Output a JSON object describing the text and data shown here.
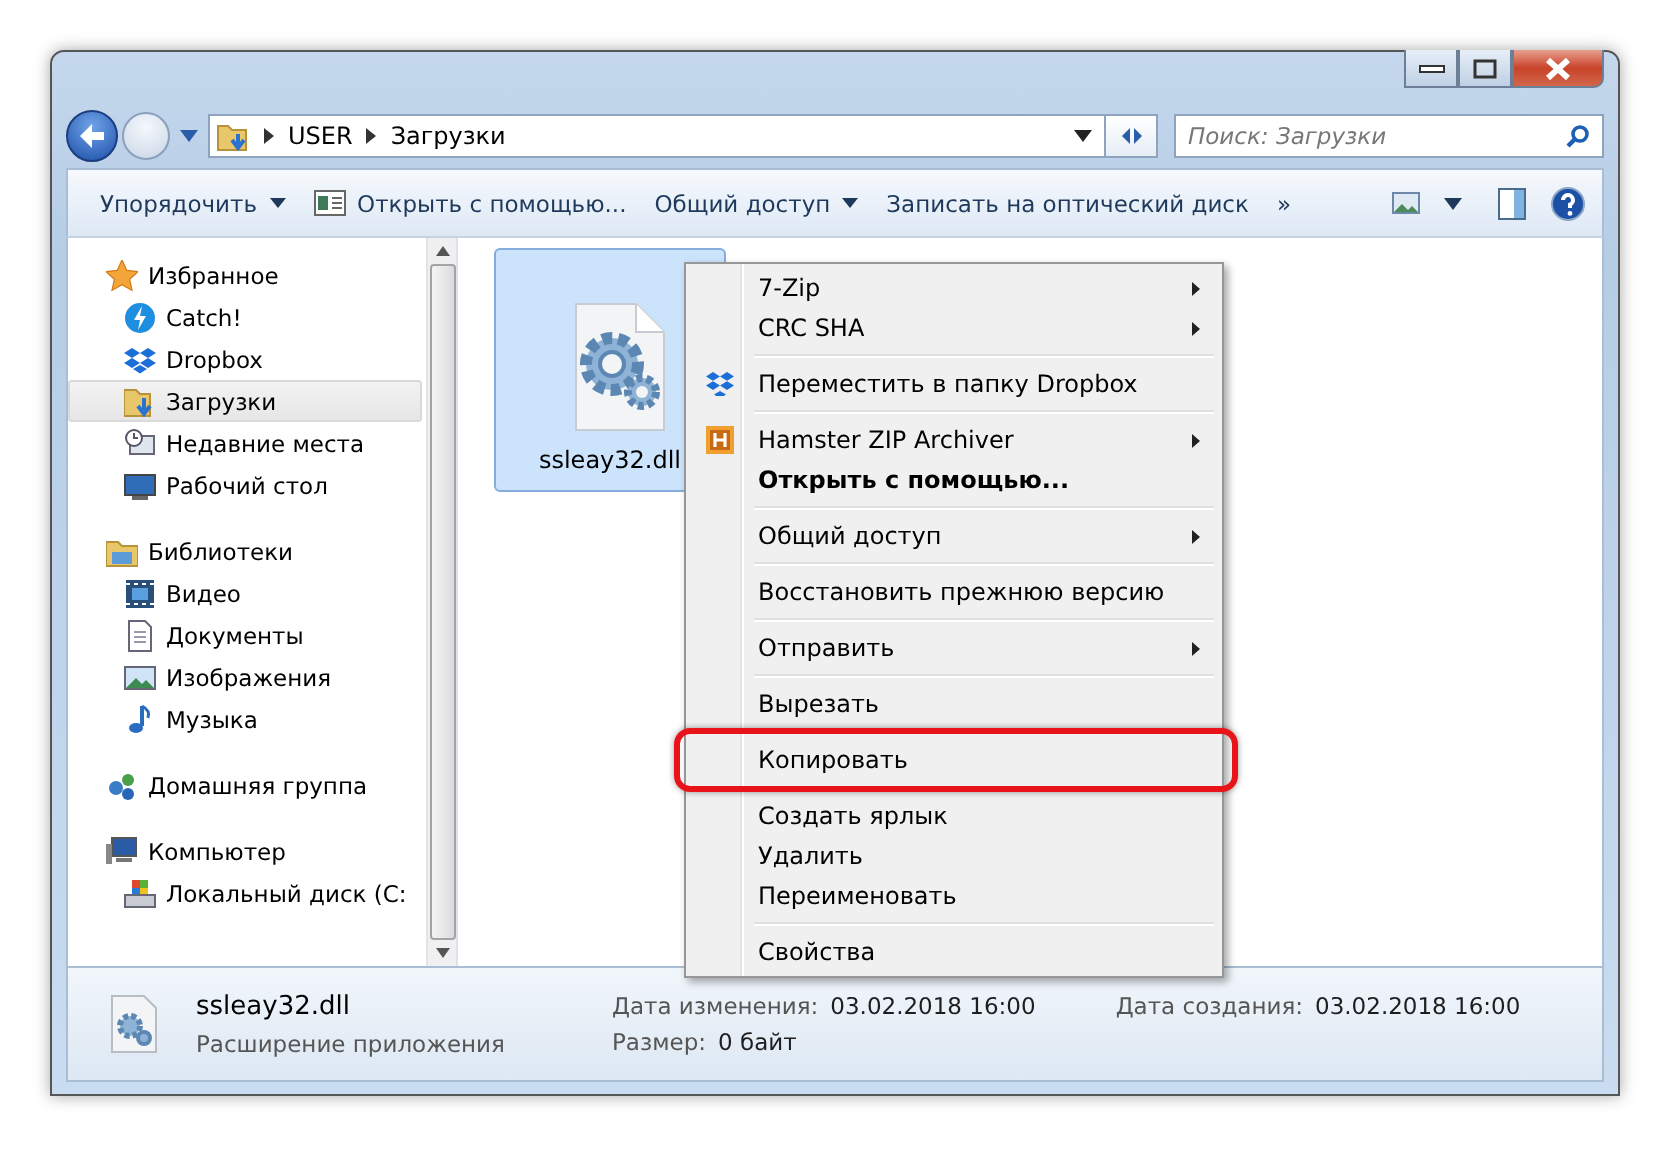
{
  "address": {
    "path": [
      "USER",
      "Загрузки"
    ]
  },
  "search": {
    "placeholder": "Поиск: Загрузки"
  },
  "toolbar": [
    {
      "label": "Упорядочить",
      "dropdown": true,
      "icon": false
    },
    {
      "label": "Открыть с помощью...",
      "dropdown": false,
      "icon": true
    },
    {
      "label": "Общий доступ",
      "dropdown": true,
      "icon": false
    },
    {
      "label": "Записать на оптический диск",
      "dropdown": false,
      "icon": false
    },
    {
      "label": "»",
      "dropdown": false,
      "icon": false
    }
  ],
  "sidebar": {
    "items": [
      {
        "label": "Избранное",
        "selected": false,
        "children": [
          {
            "label": "Catch!",
            "selected": false
          },
          {
            "label": "Dropbox",
            "selected": false
          },
          {
            "label": "Загрузки",
            "selected": true
          },
          {
            "label": "Недавние места",
            "selected": false
          },
          {
            "label": "Рабочий стол",
            "selected": false
          }
        ]
      },
      {
        "label": "Библиотеки",
        "selected": false,
        "children": [
          {
            "label": "Видео",
            "selected": false
          },
          {
            "label": "Документы",
            "selected": false
          },
          {
            "label": "Изображения",
            "selected": false
          },
          {
            "label": "Музыка",
            "selected": false
          }
        ]
      },
      {
        "label": "Домашняя группа",
        "selected": false
      },
      {
        "label": "Компьютер",
        "selected": false,
        "children": [
          {
            "label": "Локальный диск (C:",
            "selected": false
          }
        ]
      }
    ]
  },
  "files": [
    {
      "name": "ssleay32.dll",
      "selected": true
    }
  ],
  "context_menu": {
    "items": [
      {
        "kind": "item",
        "label": "7-Zip",
        "submenu": true,
        "bold": false,
        "highlighted": false
      },
      {
        "kind": "item",
        "label": "CRC SHA",
        "submenu": true,
        "bold": false,
        "highlighted": false
      },
      {
        "kind": "separator"
      },
      {
        "kind": "item",
        "label": "Переместить в папку Dropbox",
        "submenu": false,
        "bold": false,
        "highlighted": false
      },
      {
        "kind": "separator"
      },
      {
        "kind": "item",
        "label": "Hamster ZIP Archiver",
        "submenu": true,
        "bold": false,
        "highlighted": false
      },
      {
        "kind": "item",
        "label": "Открыть с помощью...",
        "submenu": false,
        "bold": true,
        "highlighted": false
      },
      {
        "kind": "separator"
      },
      {
        "kind": "item",
        "label": "Общий доступ",
        "submenu": true,
        "bold": false,
        "highlighted": false
      },
      {
        "kind": "separator"
      },
      {
        "kind": "item",
        "label": "Восстановить прежнюю версию",
        "submenu": false,
        "bold": false,
        "highlighted": false
      },
      {
        "kind": "separator"
      },
      {
        "kind": "item",
        "label": "Отправить",
        "submenu": true,
        "bold": false,
        "highlighted": false
      },
      {
        "kind": "separator"
      },
      {
        "kind": "item",
        "label": "Вырезать",
        "submenu": false,
        "bold": false,
        "highlighted": false
      },
      {
        "kind": "item",
        "label": "Копировать",
        "submenu": false,
        "bold": false,
        "highlighted": true
      },
      {
        "kind": "item",
        "label": "Создать ярлык",
        "submenu": false,
        "bold": false,
        "highlighted": false
      },
      {
        "kind": "item",
        "label": "Удалить",
        "submenu": false,
        "bold": false,
        "highlighted": false
      },
      {
        "kind": "item",
        "label": "Переименовать",
        "submenu": false,
        "bold": false,
        "highlighted": false
      },
      {
        "kind": "separator"
      },
      {
        "kind": "item",
        "label": "Свойства",
        "submenu": false,
        "bold": false,
        "highlighted": false
      }
    ]
  },
  "status_bar": {
    "name": "ssleay32.dll",
    "type": "Расширение приложения",
    "fields": [
      {
        "label": "Дата изменения:",
        "value": "03.02.2018 16:00"
      },
      {
        "label": "Дата создания:",
        "value": "03.02.2018 16:00"
      },
      {
        "label": "Размер:",
        "value": "0 байт"
      }
    ]
  }
}
